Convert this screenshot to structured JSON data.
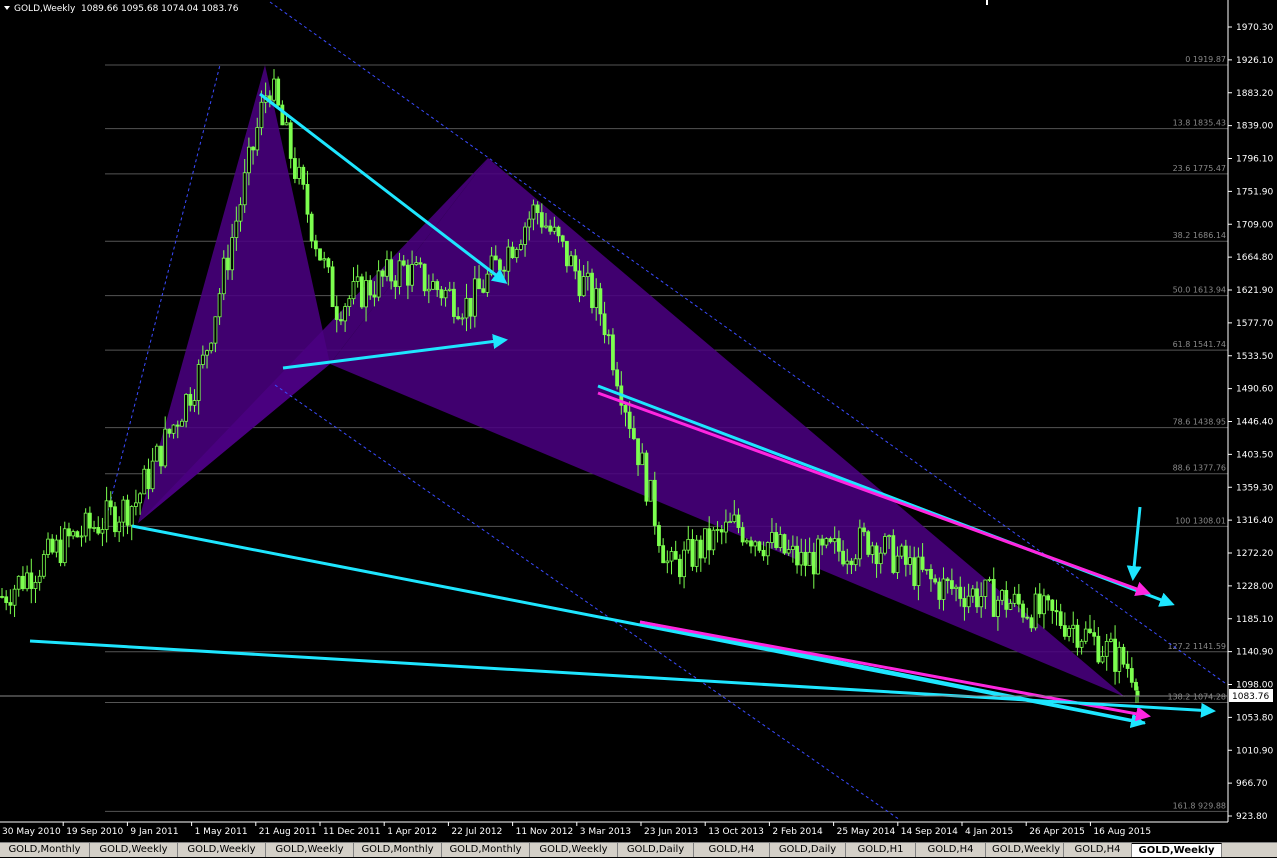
{
  "window": {
    "symbol_label": "GOLD,Weekly",
    "ohlc_label": "1089.66 1095.68 1074.04 1083.76",
    "current_price": "1083.76"
  },
  "colors": {
    "background": "#000000",
    "candle": "#7cff4f",
    "harmonic_fill": "#4b0082",
    "trendline": "#1ee6ff",
    "magenta_line": "#ff26e0",
    "channel_dots": "#3b4bff",
    "fib_line": "#555555"
  },
  "price_axis": {
    "labels": [
      "1970.30",
      "1926.10",
      "1883.20",
      "1839.00",
      "1796.10",
      "1751.90",
      "1709.00",
      "1664.80",
      "1621.90",
      "1577.70",
      "1533.50",
      "1490.60",
      "1446.40",
      "1403.50",
      "1359.30",
      "1316.40",
      "1272.20",
      "1228.00",
      "1185.10",
      "1140.90",
      "1098.00",
      "1053.80",
      "1010.90",
      "966.70",
      "923.80"
    ]
  },
  "time_axis": {
    "labels": [
      "30 May 2010",
      "19 Sep 2010",
      "9 Jan 2011",
      "1 May 2011",
      "21 Aug 2011",
      "11 Dec 2011",
      "1 Apr 2012",
      "22 Jul 2012",
      "11 Nov 2012",
      "3 Mar 2013",
      "23 Jun 2013",
      "13 Oct 2013",
      "2 Feb 2014",
      "25 May 2014",
      "14 Sep 2014",
      "4 Jan 2015",
      "26 Apr 2015",
      "16 Aug 2015"
    ]
  },
  "fib_levels": [
    {
      "ratio": "0",
      "price": "1919.87"
    },
    {
      "ratio": "13.8",
      "price": "1835.43"
    },
    {
      "ratio": "23.6",
      "price": "1775.47"
    },
    {
      "ratio": "38.2",
      "price": "1686.14"
    },
    {
      "ratio": "50.0",
      "price": "1613.94"
    },
    {
      "ratio": "61.8",
      "price": "1541.74"
    },
    {
      "ratio": "78.6",
      "price": "1438.95"
    },
    {
      "ratio": "88.6",
      "price": "1377.76"
    },
    {
      "ratio": "100",
      "price": "1308.01"
    },
    {
      "ratio": "127.2",
      "price": "1141.59"
    },
    {
      "ratio": "138.2",
      "price": "1074.28"
    },
    {
      "ratio": "161.8",
      "price": "929.88"
    }
  ],
  "tabs": [
    "GOLD,Monthly",
    "GOLD,Weekly",
    "GOLD,Weekly",
    "GOLD,Weekly",
    "GOLD,Monthly",
    "GOLD,Monthly",
    "GOLD,Weekly",
    "GOLD,Daily",
    "GOLD,H4",
    "GOLD,Daily",
    "GOLD,H1",
    "GOLD,H4",
    "GOLD,Weekly",
    "GOLD,H4",
    "GOLD,Weekly"
  ],
  "active_tab_index": 14,
  "chart_data": {
    "type": "candlestick",
    "symbol": "GOLD",
    "timeframe": "Weekly",
    "ylim": [
      923.8,
      1970.3
    ],
    "xlim": [
      "30 May 2010",
      "16 Aug 2015"
    ],
    "anchors": [
      {
        "date": "30 May 2010",
        "price": 1215
      },
      {
        "date": "19 Sep 2010",
        "price": 1290
      },
      {
        "date": "9 Jan 2011",
        "price": 1340
      },
      {
        "date": "1 May 2011",
        "price": 1520
      },
      {
        "date": "21 Aug 2011",
        "price": 1900
      },
      {
        "date": "11 Dec 2011",
        "price": 1600
      },
      {
        "date": "1 Apr 2012",
        "price": 1650
      },
      {
        "date": "22 Jul 2012",
        "price": 1600
      },
      {
        "date": "11 Nov 2012",
        "price": 1730
      },
      {
        "date": "3 Mar 2013",
        "price": 1590
      },
      {
        "date": "23 Jun 2013",
        "price": 1250
      },
      {
        "date": "13 Oct 2013",
        "price": 1310
      },
      {
        "date": "2 Feb 2014",
        "price": 1260
      },
      {
        "date": "25 May 2014",
        "price": 1290
      },
      {
        "date": "14 Sep 2014",
        "price": 1230
      },
      {
        "date": "4 Jan 2015",
        "price": 1210
      },
      {
        "date": "26 Apr 2015",
        "price": 1180
      },
      {
        "date": "16 Aug 2015",
        "price": 1115
      }
    ],
    "last_candle": {
      "open": 1089.66,
      "high": 1095.68,
      "low": 1074.04,
      "close": 1083.76
    }
  }
}
